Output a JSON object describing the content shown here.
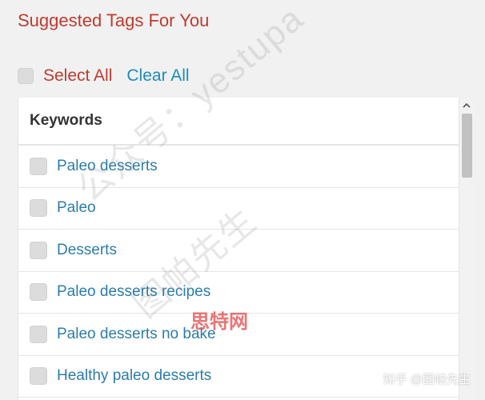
{
  "heading": "Suggested Tags For You",
  "actions": {
    "select_all_label": "Select All",
    "clear_all_label": "Clear All"
  },
  "list": {
    "column_header": "Keywords",
    "items": [
      {
        "label": "Paleo desserts",
        "checked": false
      },
      {
        "label": "Paleo",
        "checked": false
      },
      {
        "label": "Desserts",
        "checked": false
      },
      {
        "label": "Paleo desserts recipes",
        "checked": false
      },
      {
        "label": "Paleo desserts no bake",
        "checked": false
      },
      {
        "label": "Healthy paleo desserts",
        "checked": false
      }
    ]
  },
  "watermarks": {
    "diagonal_1": "公众号：yestupa",
    "diagonal_2": "图帕先生",
    "red_mark": "思特网",
    "corner": "知乎 @图帕先生"
  },
  "colors": {
    "heading_red": "#c13a2f",
    "link_blue": "#1e8cbe",
    "item_blue": "#2b7cae"
  },
  "icons": {
    "scroll_up": "chevron-up-icon"
  }
}
